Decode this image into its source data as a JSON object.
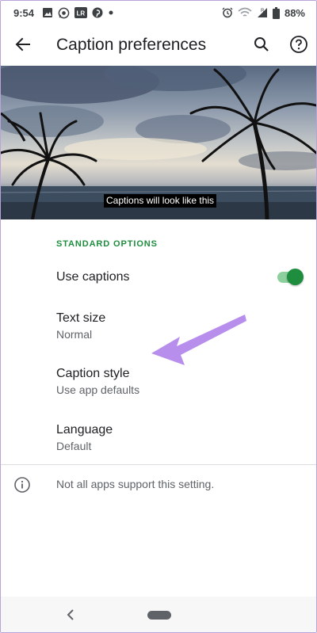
{
  "status_bar": {
    "time": "9:54",
    "left_icons": [
      "image-icon",
      "whatsapp-icon",
      "lightroom-icon",
      "pinterest-icon",
      "dot-icon"
    ],
    "right_icons": [
      "alarm-icon",
      "wifi-icon",
      "signal-icon",
      "battery-icon"
    ],
    "battery": "88%",
    "lr_label": "LR"
  },
  "app_bar": {
    "title": "Caption preferences",
    "back_icon": "arrow-back-icon",
    "search_icon": "search-icon",
    "help_icon": "help-icon"
  },
  "preview": {
    "caption_sample": "Captions will look like this"
  },
  "settings": {
    "section_header": "STANDARD OPTIONS",
    "use_captions": {
      "label": "Use captions",
      "enabled": true
    },
    "text_size": {
      "label": "Text size",
      "value": "Normal"
    },
    "caption_style": {
      "label": "Caption style",
      "value": "Use app defaults"
    },
    "language": {
      "label": "Language",
      "value": "Default"
    }
  },
  "footer": {
    "info_text": "Not all apps support this setting."
  },
  "colors": {
    "accent": "#1e8e3e",
    "toggle_track": "#8ecf9e",
    "annotation_arrow": "#b388eb"
  }
}
